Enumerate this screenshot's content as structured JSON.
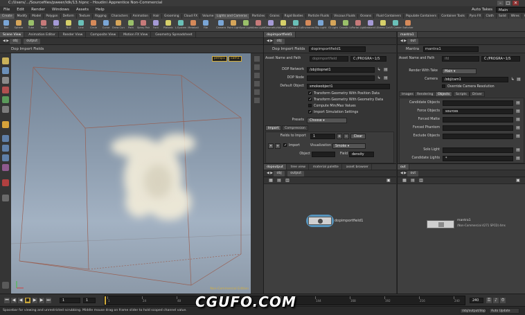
{
  "window": {
    "title": "C:/Users/.../Sourcefiles/pweer/idk/13.hipnc - Houdini Apprentice Non-Commercial",
    "controls": [
      "–",
      "□",
      "✕"
    ]
  },
  "menu": [
    "File",
    "Edit",
    "Render",
    "Windows",
    "Assets",
    "Help"
  ],
  "desktop": {
    "label": "Auto Takes",
    "value": "Main"
  },
  "shelf_tabs": [
    "Create",
    "Modify",
    "Model",
    "Polygon",
    "Deform",
    "Texture",
    "Rigging",
    "Characters",
    "Animation",
    "Hair",
    "Grooming",
    "Cloud FX",
    "Volume",
    "Lights and Cameras",
    "Particles",
    "Grains",
    "Rigid Bodies",
    "Particle Fluids",
    "Viscous Fluids",
    "Oceans",
    "Fluid Containers",
    "Populate Containers",
    "Container Tools",
    "Pyro FX",
    "Cloth",
    "Solid",
    "Wires",
    "Crowds",
    "Drive Simulation"
  ],
  "shelf_left": [
    "Box",
    "Sphere",
    "Tube",
    "Torus",
    "Grid",
    "Null",
    "Line",
    "Circle",
    "Curve",
    "Draw Curve",
    "Path",
    "Spray Paint",
    "Font",
    "Platonic",
    "L-System",
    "Metaball",
    "File"
  ],
  "shelf_right": [
    "Camera",
    "Point Light",
    "Spot Light",
    "Area Light",
    "Geometry Light",
    "Volume Light",
    "Distant Light",
    "Environment",
    "Sky Light",
    "GI Light",
    "Caustic Light",
    "Portal Light",
    "Ambient Light",
    "Stereo Camera",
    "VR Camera",
    "Switcher"
  ],
  "viewport": {
    "tabs": [
      "Scene View",
      "Animation Editor",
      "Render View",
      "Composite View",
      "Motion FX View",
      "Geometry Spreadsheet"
    ],
    "path": [
      "obj",
      "output"
    ],
    "title": "Dop Import Fields",
    "camera_badges": [
      "persp1",
      "cam1"
    ],
    "watermark": "Non-Commercial Edition"
  },
  "params": {
    "tab": "dopimportfield1",
    "path": "obj",
    "node_type": "Dop Import Fields",
    "node_name": "dopimportfield1",
    "asset_label": "Asset Name and Path",
    "asset_value": "dopimportfield",
    "asset_path": "C:/PROGRA~1/S",
    "dop_network_label": "DOP Network",
    "dop_network": "/obj/dopnet1",
    "dop_node_label": "DOP Node",
    "dop_node": "",
    "default_object_label": "Default Object",
    "default_object": "smokeobject1",
    "checks": [
      {
        "label": "Transform Geometry With Position Data",
        "on": true
      },
      {
        "label": "Transform Geometry With Geometry Data",
        "on": true
      },
      {
        "label": "Compute Min/Max Values",
        "on": false
      },
      {
        "label": "Import Simulation Settings",
        "on": true
      }
    ],
    "presets_label": "Presets",
    "presets_value": "Choose",
    "subtabs": [
      "Import",
      "Compression"
    ],
    "fields_to_import_label": "Fields to Import",
    "fields_to_import": "1",
    "clear_label": "Clear",
    "import_label": "Import",
    "visualization_label": "Visualization",
    "visualization_value": "Smoke",
    "object_label": "Object",
    "field_label": "Field",
    "field_value": "density"
  },
  "mantra": {
    "tab": "mantra1",
    "path": "out",
    "node_type": "Mantra",
    "node_name": "mantra1",
    "asset_label": "Asset Name and Path",
    "asset_value": "ifd",
    "asset_path": "C:/PROGRA~1/S",
    "render_with_take_label": "Render With Take",
    "render_with_take": "Main",
    "camera_label": "Camera",
    "camera": "/obj/cam1",
    "override_label": "Override Camera Resolution",
    "subtabs": [
      "Images",
      "Rendering",
      "Objects",
      "Scripts",
      "Driver"
    ],
    "rows": [
      {
        "label": "Candidate Objects",
        "value": ""
      },
      {
        "label": "Force Objects",
        "value": "sources"
      },
      {
        "label": "Forced Matte",
        "value": ""
      },
      {
        "label": "Forced Phantom",
        "value": ""
      },
      {
        "label": "Exclude Objects",
        "value": ""
      },
      {
        "label": "Solo Light",
        "value": ""
      },
      {
        "label": "Candidate Lights",
        "value": "*"
      }
    ]
  },
  "net_left": {
    "tabs": [
      "dopoutput",
      "tree view",
      "material palette",
      "asset browser"
    ],
    "path": "obj",
    "path2": "output",
    "node_label": "dopimportfield1"
  },
  "net_right": {
    "tabs": [
      "out"
    ],
    "path": "out",
    "node_label": "mantra1",
    "node_sub": "(Non-Commercial 4271 SPCD) 4ms"
  },
  "timeline": {
    "current_frame": "1",
    "start": "1",
    "end": "240",
    "ticks": [
      "1",
      "24",
      "48",
      "72",
      "96",
      "120",
      "144",
      "168",
      "192",
      "216",
      "240"
    ],
    "auto_update": "Auto Update"
  },
  "status": {
    "message": "Spacebar for viewing and unrestricted scrubbing. Middle mouse drag on frame slider to hold scoped channel value.",
    "right_path": "/obj/output/dopimport",
    "auto_label": "Auto Update"
  },
  "watermark": "CGUFO.COM"
}
